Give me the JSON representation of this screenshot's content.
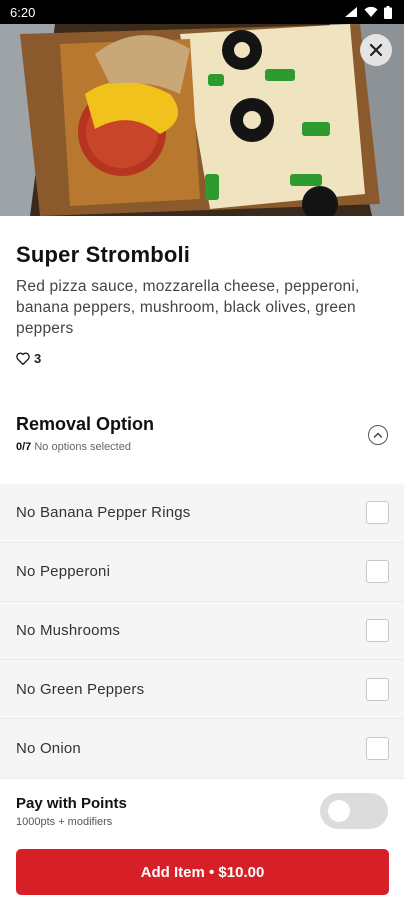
{
  "status_bar": {
    "time": "6:20"
  },
  "item": {
    "title": "Super Stromboli",
    "description": "Red pizza sauce, mozzarella cheese, pepperoni, banana peppers, mushroom, black olives, green peppers",
    "likes": "3"
  },
  "removal_section": {
    "title": "Removal Option",
    "count": "0/7",
    "status": "No options selected",
    "options": [
      {
        "label": "No Banana Pepper Rings"
      },
      {
        "label": "No Pepperoni"
      },
      {
        "label": "No Mushrooms"
      },
      {
        "label": "No Green Peppers"
      },
      {
        "label": "No Onion"
      }
    ]
  },
  "footer": {
    "points_title": "Pay with Points",
    "points_sub": "1000pts + modifiers",
    "add_button_label": "Add Item • $10.00"
  },
  "colors": {
    "accent": "#d61f26"
  },
  "icons": {
    "close": "close-icon",
    "heart": "heart-icon",
    "collapse": "chevron-up-icon"
  }
}
